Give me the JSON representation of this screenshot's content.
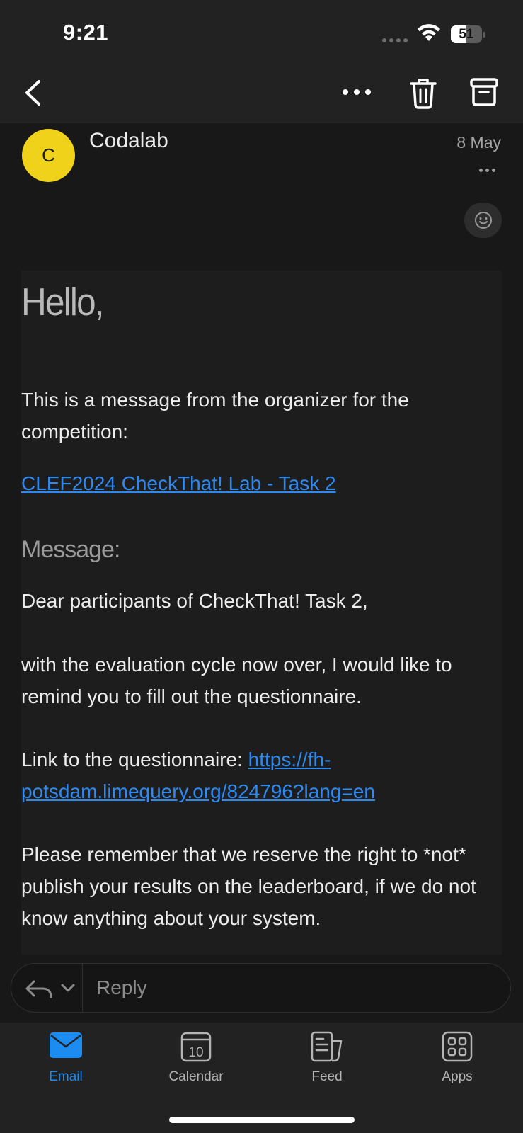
{
  "status_bar": {
    "time": "9:21",
    "battery_percent": 51,
    "battery_label": "51"
  },
  "toolbar": {
    "back": "back-icon",
    "more": "more-icon",
    "delete": "trash-icon",
    "archive": "archive-icon"
  },
  "email": {
    "avatar_initial": "C",
    "sender": "Codalab",
    "date": "8 May",
    "greeting": "Hello,",
    "intro": "This is a message from the organizer for the competition:",
    "competition_link": "CLEF2024 CheckThat! Lab - Task 2",
    "message_label": "Message:",
    "salutation": "Dear participants of CheckThat! Task 2,",
    "reminder": "with the evaluation cycle now over, I would like to remind you to fill out the questionnaire.",
    "questionnaire_prefix": "Link to the questionnaire: ",
    "questionnaire_url": "https://fh-potsdam.limequery.org/824796?lang=en",
    "notice": "Please remember that we reserve the right to *not* publish your results on the leaderboard, if we do not know anything about your system."
  },
  "reply": {
    "placeholder": "Reply"
  },
  "tabs": [
    {
      "label": "Email",
      "icon": "mail-icon",
      "active": true
    },
    {
      "label": "Calendar",
      "icon": "calendar-icon",
      "day": "10"
    },
    {
      "label": "Feed",
      "icon": "feed-icon"
    },
    {
      "label": "Apps",
      "icon": "apps-icon"
    }
  ],
  "colors": {
    "accent": "#1c8cf0",
    "link": "#2d8af2",
    "avatar": "#f0d21b"
  }
}
